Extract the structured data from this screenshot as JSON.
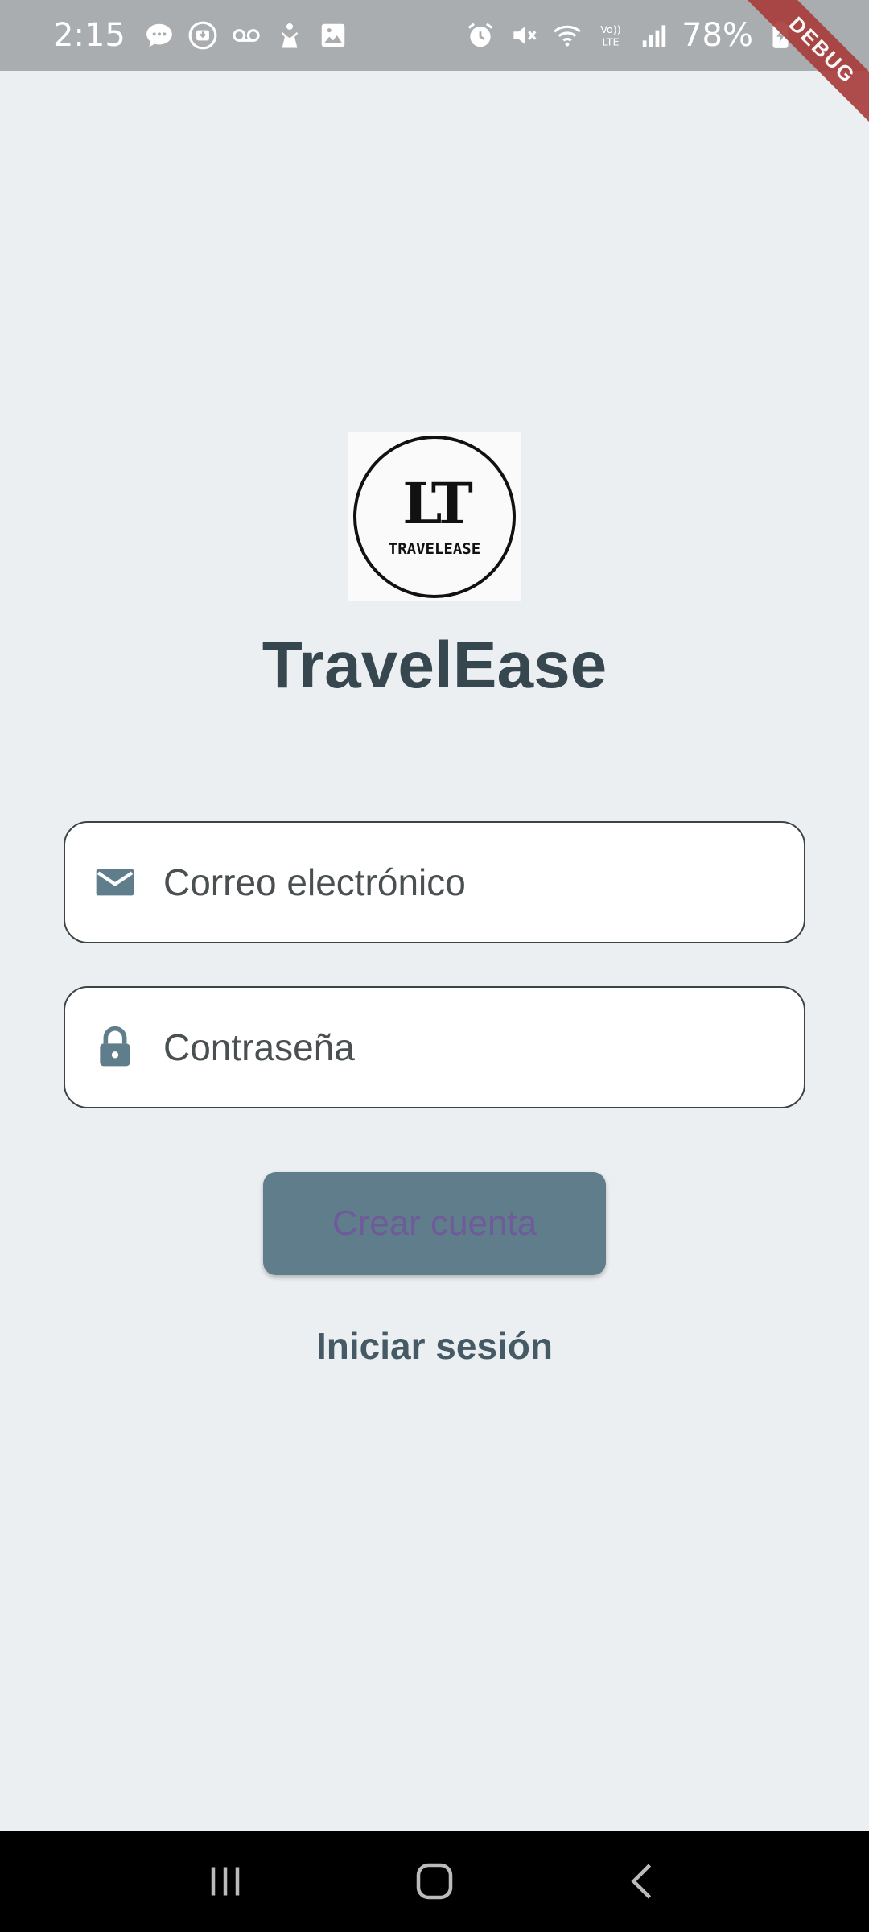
{
  "status_bar": {
    "time": "2:15",
    "battery": "78%",
    "left_icons": [
      "chat-bubble-icon",
      "download-icon",
      "voicemail-icon",
      "hand-icon",
      "image-icon"
    ],
    "right_icons": [
      "alarm-icon",
      "mute-icon",
      "wifi-icon",
      "volte-icon",
      "signal-icon",
      "battery-charging-icon"
    ]
  },
  "debug_banner": "DEBUG",
  "logo": {
    "monogram": "LT",
    "wordmark": "TRAVELEASE"
  },
  "app_title": "TravelEase",
  "email": {
    "placeholder": "Correo electrónico",
    "value": ""
  },
  "password": {
    "placeholder": "Contraseña",
    "value": ""
  },
  "create_button_label": "Crear cuenta",
  "login_link_label": "Iniciar sesión",
  "colors": {
    "background": "#eceff2",
    "title": "#37474f",
    "icon": "#607d8b",
    "button": "#607d8b",
    "button_text": "#6f5a9a",
    "link": "#455a64"
  }
}
